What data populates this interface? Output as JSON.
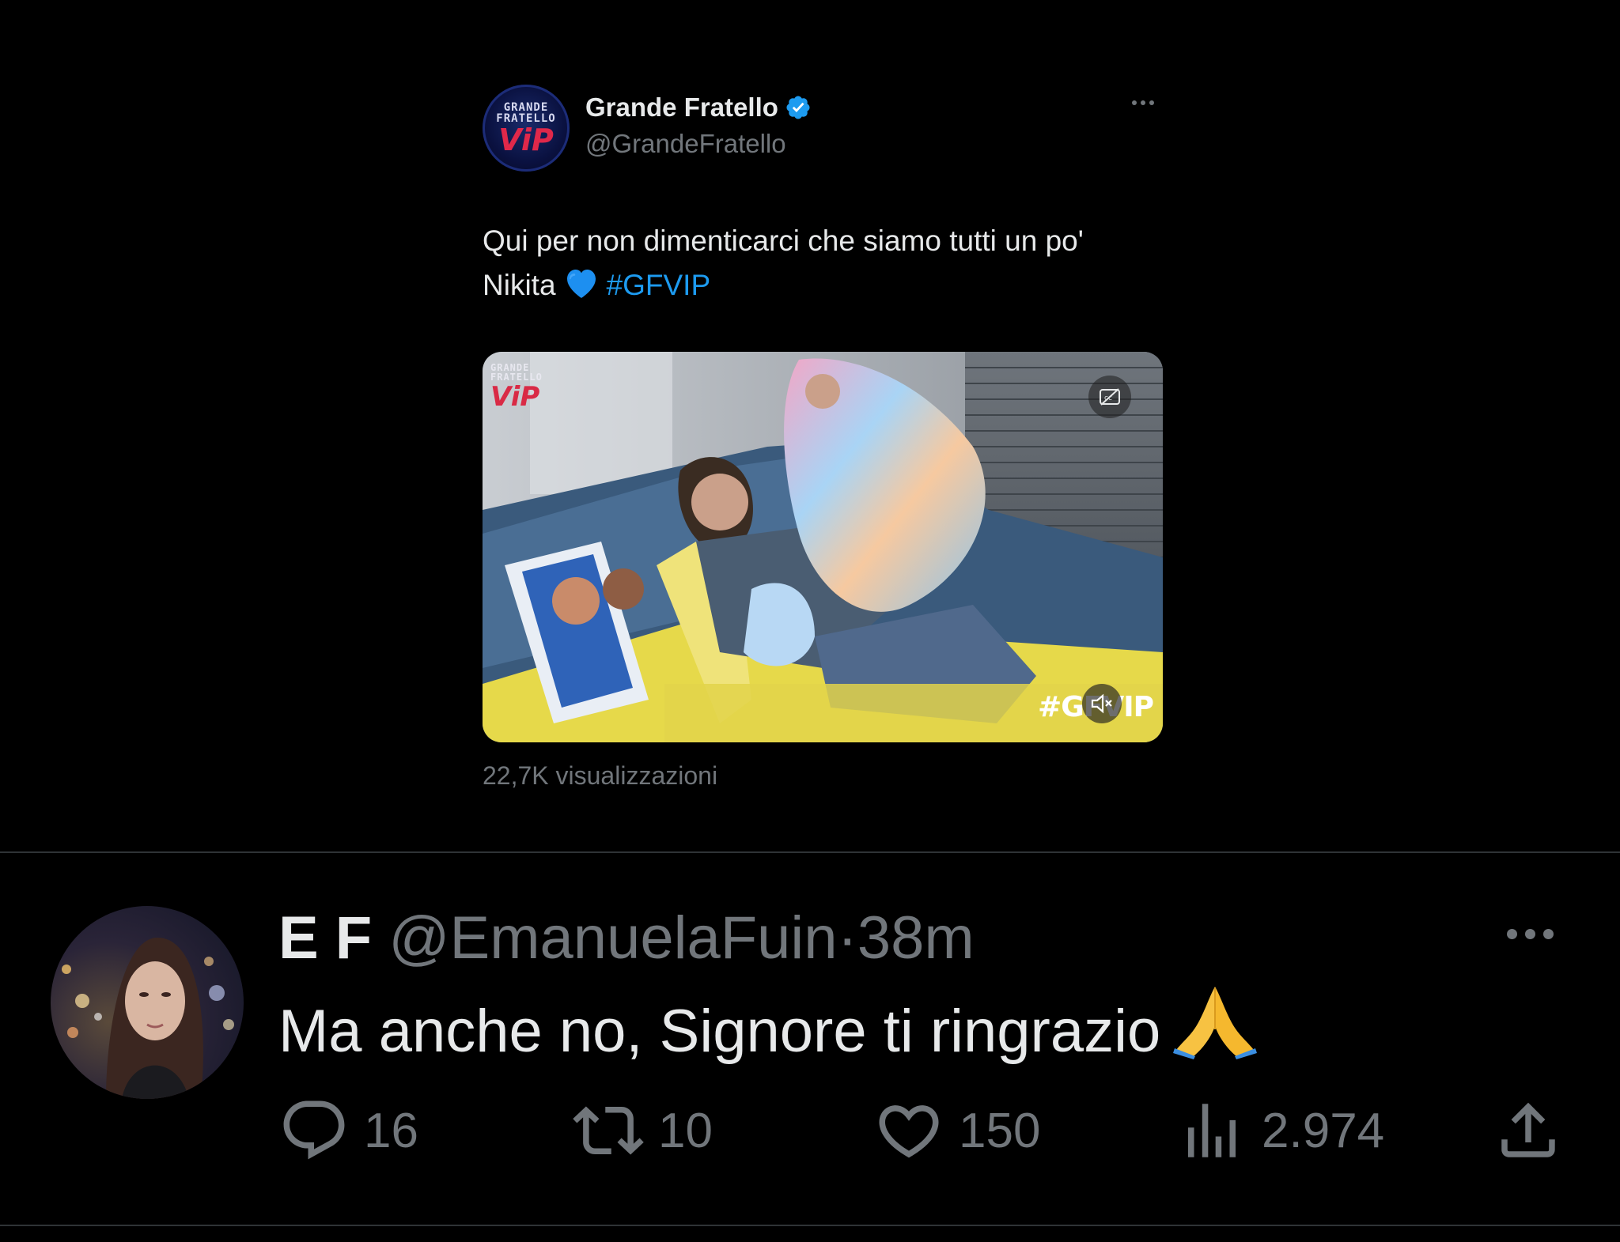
{
  "quoted_tweet": {
    "avatar_text_top": "GRANDE\nFRATELLO",
    "avatar_text_vip": "ViP",
    "name": "Grande Fratello",
    "handle": "@GrandeFratello",
    "text_main": "Qui per non dimenticarci che siamo tutti un po' Nikita",
    "emoji": "💙",
    "hashtag": "#GFVIP",
    "media": {
      "logo_top": "GRANDE FRATELLO",
      "logo_vip": "ViP",
      "overlay_hashtag": "#GFVIP",
      "captions_icon": "captions-off-icon",
      "mute_icon": "speaker-muted-icon"
    },
    "views": "22,7K visualizzazioni"
  },
  "reply_tweet": {
    "name": "E F",
    "handle": "@EmanuelaFuin",
    "separator": "·",
    "time": "38m",
    "text": "Ma anche no, Signore ti ringrazio",
    "emoji": "🙏",
    "actions": {
      "replies": "16",
      "retweets": "10",
      "likes": "150",
      "views": "2.974"
    }
  },
  "colors": {
    "background": "#000000",
    "text_primary": "#e7e9ea",
    "text_secondary": "#71767b",
    "link_blue": "#1d9bf0",
    "divider": "#2f3336"
  }
}
